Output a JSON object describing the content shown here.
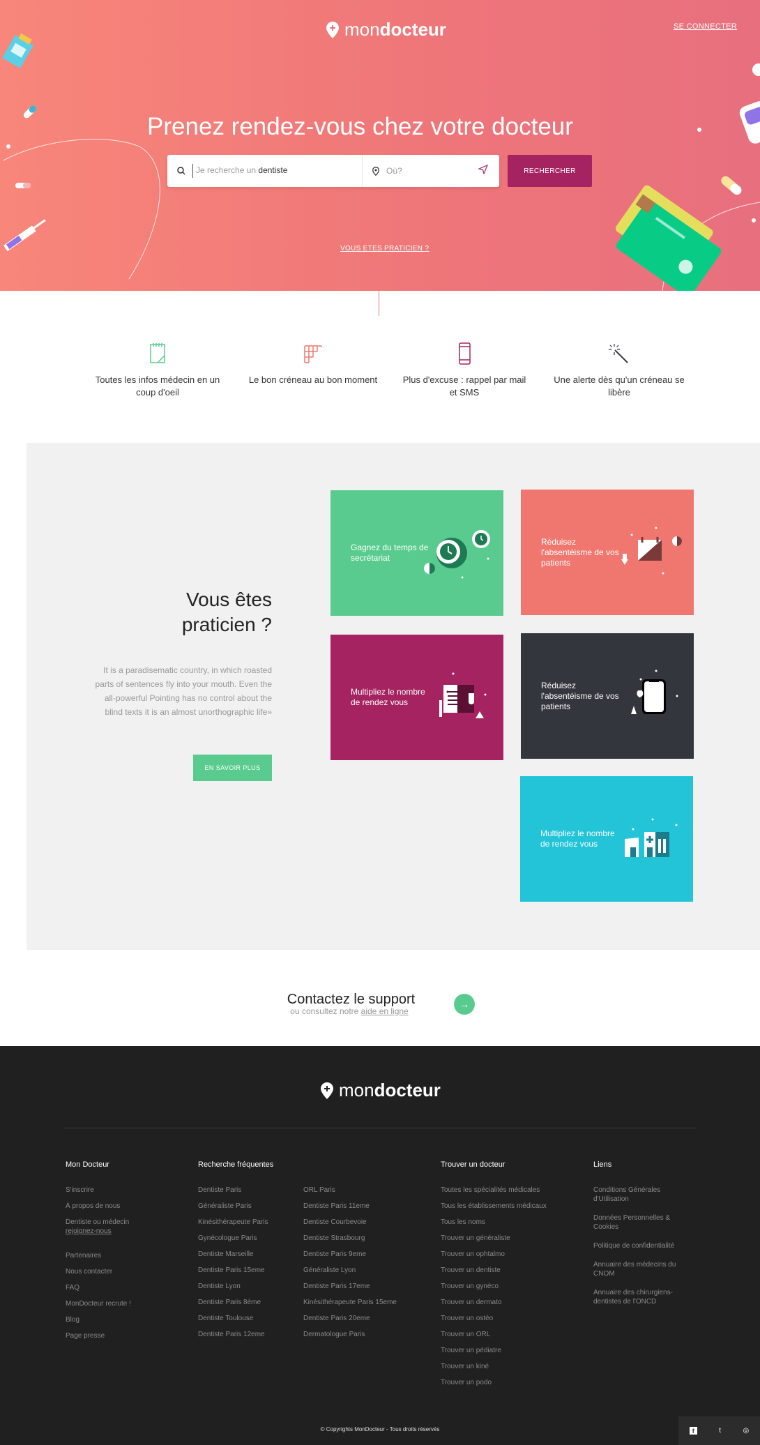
{
  "header": {
    "logo_light": "mon",
    "logo_bold": "docteur",
    "login": "SE CONNECTER"
  },
  "hero": {
    "title": "Prenez rendez-vous chez votre docteur",
    "search_what_prefix": "Je recherche un",
    "search_what_value": "dentiste",
    "search_where_placeholder": "Où?",
    "search_button": "RECHERCHER",
    "praticien_link": "VOUS ETES PRATICIEN ?"
  },
  "features": [
    {
      "icon": "notepad-icon",
      "label": "Toutes les infos médecin en un coup d'oeil"
    },
    {
      "icon": "calendar-grid-icon",
      "label": "Le bon créneau au bon moment"
    },
    {
      "icon": "smartphone-icon",
      "label": "Plus d'excuse : rappel par mail et SMS"
    },
    {
      "icon": "magic-wand-icon",
      "label": "Une alerte dès qu'un créneau se libère"
    }
  ],
  "pro": {
    "title_line1": "Vous êtes",
    "title_line2": "praticien ?",
    "text": "It is a paradisematic country, in which roasted parts of sentences fly into your mouth. Even the all-powerful Pointing has no control about the blind texts it is an almost unorthographic life»",
    "button": "EN SAVOIR PLUS",
    "cards": [
      {
        "label": "Gagnez du temps de secrétariat",
        "color": "#5acb8e",
        "icon": "clock-icon"
      },
      {
        "label": "Réduisez l'absentéisme de vos patients",
        "color": "#f0776f",
        "icon": "calendar-icon"
      },
      {
        "label": "Multipliez le nombre de rendez vous",
        "color": "#a62361",
        "icon": "document-icon"
      },
      {
        "label": "Réduisez l'absentéisme de vos patients",
        "color": "#33363d",
        "icon": "phone-icon"
      },
      {
        "label": "Multipliez le nombre de rendez vous",
        "color": "#23c4d8",
        "icon": "hospital-icon"
      }
    ]
  },
  "support": {
    "title": "Contactez le support",
    "sub_prefix": "ou consultez notre",
    "sub_link": "aide en ligne",
    "arrow": "→"
  },
  "footer": {
    "logo_light": "mon",
    "logo_bold": "docteur",
    "col1": {
      "title": "Mon Docteur",
      "links": [
        "S'inscrire",
        "À propos de nous",
        "Dentiste ou médecin",
        "rejoignez-nous",
        "Partenaires",
        "Nous contacter",
        "FAQ",
        "MonDocteur recrute !",
        "Blog",
        "Page presse"
      ]
    },
    "col2": {
      "title": "Recherche fréquentes",
      "links_a": [
        "Dentiste Paris",
        "Généraliste Paris",
        "Kinésithérapeute Paris",
        "Gynécologue Paris",
        "Dentiste Marseille",
        "Dentiste Paris 15eme",
        "Dentiste Lyon",
        "Dentiste Paris 8ème",
        "Dentiste Toulouse",
        "Dentiste Paris 12eme"
      ],
      "links_b": [
        "ORL Paris",
        "Dentiste Paris 11eme",
        "Dentiste Courbevoie",
        "Dentiste Strasbourg",
        "Dentiste Paris 9eme",
        "Généraliste Lyon",
        "Dentiste Paris 17eme",
        "Kinésithérapeute Paris 15eme",
        "Dentiste Paris 20eme",
        "Dermatologue Paris"
      ]
    },
    "col3": {
      "title": "Trouver un docteur",
      "links": [
        "Toutes les spécialités médicales",
        "Tous les établissements médicaux",
        "Tous les noms",
        "Trouver un généraliste",
        "Trouver un ophtalmo",
        "Trouver un dentiste",
        "Trouver un gynéco",
        "Trouver un dermato",
        "Trouver un ostéo",
        "Trouver un ORL",
        "Trouver un pédiatre",
        "Trouver un kiné",
        "Trouver un podo"
      ]
    },
    "col4": {
      "title": "Liens",
      "links": [
        "Conditions Générales d'Utilisation",
        "Données Personnelles & Cookies",
        "Politique de confidentialité",
        "Annuaire des médecins du CNOM",
        "Annuaire des chirurgiens-dentistes de l'ONCD"
      ]
    },
    "copyright": "© Copyrights MonDocteur - Tous droits réservés",
    "social": [
      {
        "icon": "facebook-icon",
        "glyph": "f"
      },
      {
        "icon": "twitter-icon",
        "glyph": "t"
      },
      {
        "icon": "instagram-icon",
        "glyph": "◎"
      }
    ]
  },
  "colors": {
    "accent": "#a62361",
    "green": "#5acb8e",
    "hero_start": "#f8867a",
    "hero_end": "#e8707e"
  }
}
